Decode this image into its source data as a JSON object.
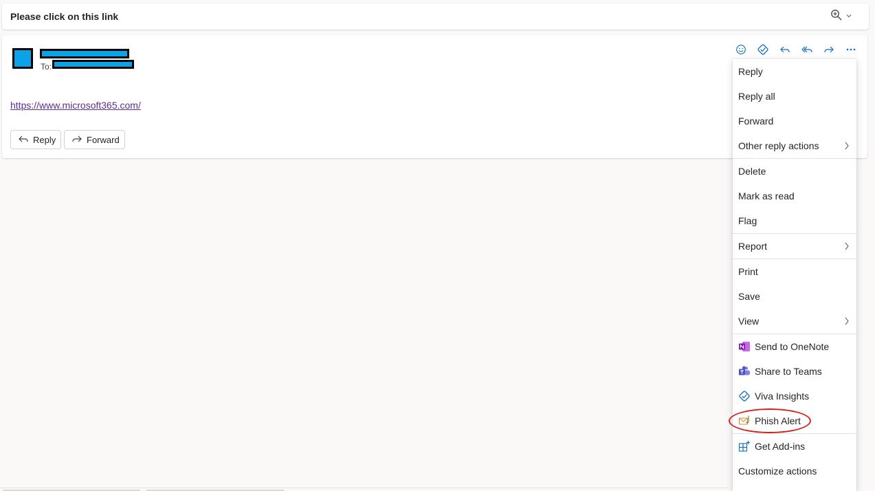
{
  "subject": {
    "title": "Please click on this link",
    "zoom_icon": "zoom-in-icon",
    "zoom_chevron_icon": "chevron-down-icon"
  },
  "message": {
    "to_label": "To:",
    "link_text": "https://www.microsoft365.com/",
    "reply_label": "Reply",
    "forward_label": "Forward",
    "link_color": "#5c2d91",
    "redaction_color": "#0aa3e8"
  },
  "toolbar": {
    "icons": [
      "emoji-icon",
      "viva-insights-icon",
      "reply-icon",
      "reply-all-icon",
      "forward-icon",
      "more-options-icon"
    ]
  },
  "menu": {
    "items": [
      {
        "label": "Reply"
      },
      {
        "label": "Reply all"
      },
      {
        "label": "Forward"
      },
      {
        "label": "Other reply actions",
        "submenu": true
      },
      {
        "label": "Delete"
      },
      {
        "label": "Mark as read"
      },
      {
        "label": "Flag"
      },
      {
        "label": "Report",
        "submenu": true
      },
      {
        "label": "Print"
      },
      {
        "label": "Save"
      },
      {
        "label": "View",
        "submenu": true
      },
      {
        "label": "Send to OneNote",
        "icon": "onenote-icon"
      },
      {
        "label": "Share to Teams",
        "icon": "teams-icon"
      },
      {
        "label": "Viva Insights",
        "icon": "viva-insights-icon"
      },
      {
        "label": "Phish Alert",
        "icon": "phish-alert-icon",
        "highlighted": true
      },
      {
        "label": "Get Add-ins",
        "icon": "get-addins-icon"
      },
      {
        "label": "Customize actions"
      }
    ],
    "highlight_color": "#d32222"
  }
}
